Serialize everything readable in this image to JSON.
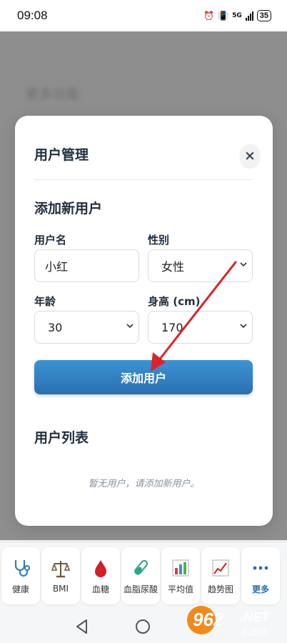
{
  "status": {
    "time": "09:08",
    "network": "5G",
    "battery": "35"
  },
  "background": {
    "title": "更多功能"
  },
  "modal": {
    "title": "用户管理",
    "close_symbol": "×",
    "add_section_title": "添加新用户",
    "fields": {
      "username": {
        "label": "用户名",
        "value": "小红"
      },
      "gender": {
        "label": "性别",
        "value": "女性"
      },
      "age": {
        "label": "年龄",
        "value": "30"
      },
      "height": {
        "label": "身高 (cm)",
        "value": "170"
      }
    },
    "add_button": "添加用户",
    "list_title": "用户列表",
    "empty_message": "暂无用户，请添加新用户。"
  },
  "tabs": [
    {
      "label": "健康",
      "icon": "stethoscope-icon"
    },
    {
      "label": "BMI",
      "icon": "scale-icon"
    },
    {
      "label": "血糖",
      "icon": "blood-drop-icon"
    },
    {
      "label": "血脂尿酸",
      "icon": "test-tube-icon"
    },
    {
      "label": "平均值",
      "icon": "bar-chart-icon"
    },
    {
      "label": "趋势图",
      "icon": "trend-chart-icon"
    },
    {
      "label": "更多",
      "icon": "more-dots-icon"
    }
  ],
  "watermark": {
    "number": "962",
    "suffix": ".NET",
    "site": "乐游网"
  },
  "colors": {
    "accent": "#2a6fb0",
    "annotation_arrow": "#d9242a"
  }
}
